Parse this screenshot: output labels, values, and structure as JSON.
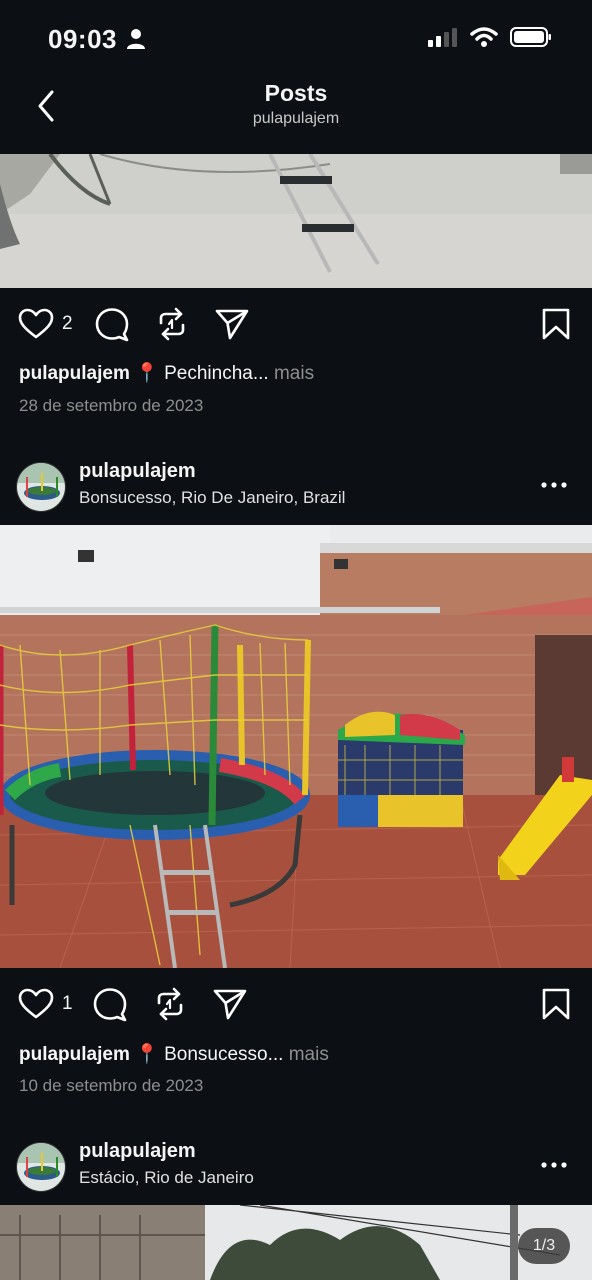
{
  "status": {
    "time": "09:03"
  },
  "nav": {
    "title": "Posts",
    "subtitle": "pulapulajem"
  },
  "post1": {
    "likes": "2",
    "user": "pulapulajem",
    "location_preview": "Pechincha...",
    "more": "mais",
    "date": "28 de setembro de 2023"
  },
  "post2": {
    "user": "pulapulajem",
    "location": "Bonsucesso, Rio De Janeiro, Brazil",
    "likes": "1",
    "caption_user": "pulapulajem",
    "location_preview": "Bonsucesso...",
    "more": "mais",
    "date": "10 de setembro de 2023"
  },
  "post3": {
    "user": "pulapulajem",
    "location": "Estácio, Rio de Janeiro",
    "carousel_counter": "1/3"
  },
  "colors": {
    "background": "#0c1014",
    "muted": "#8e8e8e",
    "pin": "#e0245e"
  },
  "icons": [
    "person-icon",
    "signal-icon",
    "wifi-icon",
    "battery-icon",
    "back-chevron-icon",
    "heart-icon",
    "comment-icon",
    "repost-icon",
    "share-icon",
    "bookmark-icon",
    "more-icon",
    "pin-icon"
  ]
}
